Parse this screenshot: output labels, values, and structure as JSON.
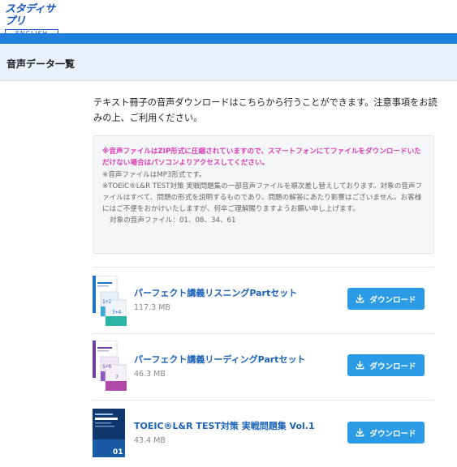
{
  "logo": {
    "jp": "スタディサプリ",
    "en": "ENGLISH"
  },
  "page_title": "音声データ一覧",
  "intro": "テキスト冊子の音声ダウンロードはこちらから行うことができます。注意事項をお読みの上、ご利用ください。",
  "notice": {
    "warning": "※音声ファイルはZIP形式に圧縮されていますので、スマートフォンにてファイルをダウンロードいただけない場合はパソコンよりアクセスしてください。",
    "format": "※音声ファイルはMP3形式です。",
    "replace": "※TOEIC®L&R TEST対策 実戦問題集の一部音声ファイルを順次差し替えしております。対象の音声ファイルはすべて、問題の形式を説明するものであり、問題の解答にあたり影響はございません。お客様にはご不便をおかけいたしますが、何卒ご理解賜りますようお願い申し上げます。",
    "targets": "対象の音声ファイル：01、08、34、61"
  },
  "items": [
    {
      "title": "パーフェクト講義リスニングPartセット",
      "size": "117.3 MB",
      "button": "ダウンロード",
      "cover_label": "1-2 / 3-4"
    },
    {
      "title": "パーフェクト講義リーディングPartセット",
      "size": "46.3 MB",
      "button": "ダウンロード",
      "cover_label": "5-6 / 7"
    },
    {
      "title": "TOEIC®L&R TEST対策 実戦問題集 Vol.1",
      "size": "43.4 MB",
      "button": "ダウンロード",
      "cover_label": "01"
    }
  ],
  "colors": {
    "brand": "#1a56c4",
    "bar": "#1e7fdc",
    "button": "#2b9be6",
    "warning": "#d83bb6",
    "link": "#1b62b8"
  }
}
